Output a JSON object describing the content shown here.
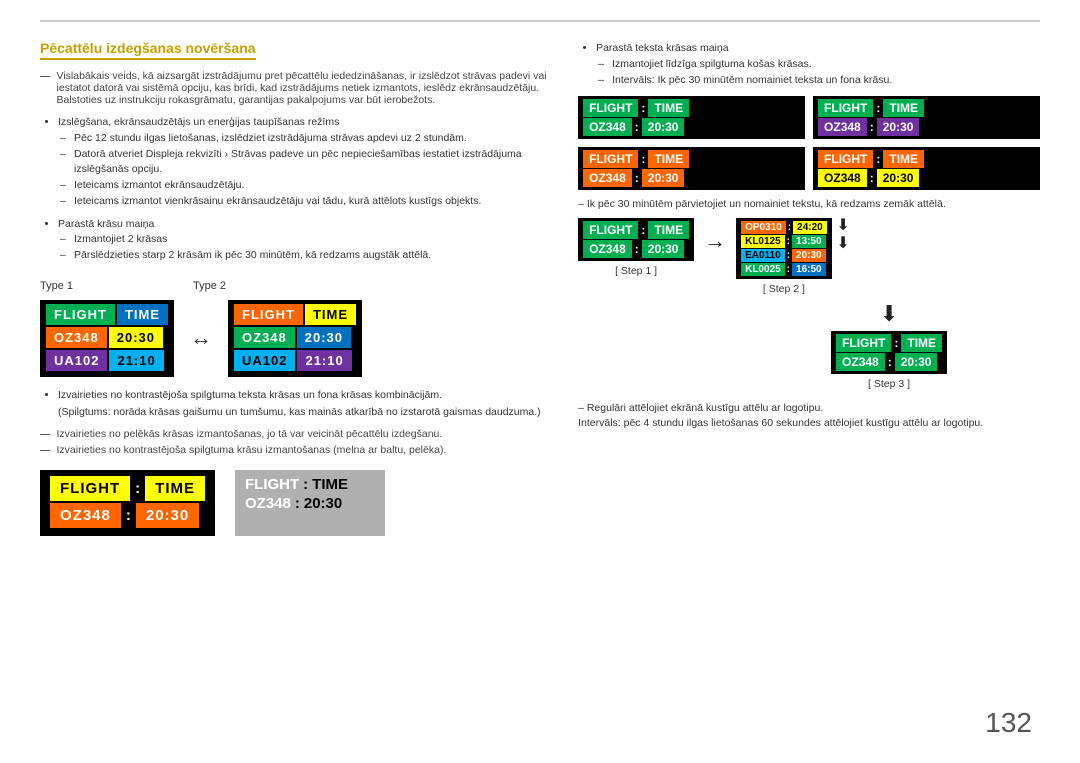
{
  "page": {
    "number": "132",
    "top_rule": true
  },
  "section": {
    "title": "Pēcattēlu izdegšanas novēršana"
  },
  "left": {
    "note1": "Vislabākais veids, kā aizsargāt izstrādājumu pret pēcattēlu iededzināšanas, ir izslēdzot strāvas padevi vai iestatot datorā vai sistēmā opciju, kas brīdi, kad izstrādājums netiek izmantots, ieslēdz ekrānsaudzētāju. Balstoties uz instrukciju rokasgrāmatu, garantijas pakalpojums var būt ierobežots.",
    "bullet1": "Izslēgšana, ekrānsaudzētājs un enerģijas taupīšanas režīms",
    "dash1": "Pēc 12 stundu ilgas lietošanas, izslēdziet izstrādājuma strāvas apdevi uz 2 stundām.",
    "dash2": "Datorā atveriet Displeja rekvizīti › Strāvas padeve un pēc nepieciešamības iestatiet izstrādājuma izslēgšanās opciju.",
    "dash3": "Ieteicams izmantot ekrānsaudzētāju.",
    "dash4": "Ieteicams izmantot vienkrāsainu ekrānsaudzētāju vai tādu, kurā attēlots kustīgs objekts.",
    "bullet2": "Parastā krāsu maiņa",
    "dash5": "Izmantojiet 2 krāsas",
    "dash6": "Pārslēdzieties starp 2 krāsām ik pēc 30 minūtēm, kā redzams augstāk attēlā.",
    "type1_label": "Type 1",
    "type2_label": "Type 2",
    "type1": {
      "row1": [
        "FLIGHT",
        "TIME"
      ],
      "row2": [
        "OZ348",
        "20:30"
      ],
      "row3": [
        "UA102",
        "21:10"
      ]
    },
    "type2": {
      "row1": [
        "FLIGHT",
        "TIME"
      ],
      "row2": [
        "OZ348",
        "20:30"
      ],
      "row3": [
        "UA102",
        "21:10"
      ]
    },
    "note2": "Izvairieties no kontrastējoša spilgtuma teksta krāsas un fona krāsas kombinācijām.",
    "note2b": "(Spilgtums: norāda krāsas gaišumu un tumšumu, kas mainās atkarībā no izstarotā gaismas daudzuma.)",
    "note3": "Izvairieties no pelēkās krāsas izmantošanas, jo tā var veicināt pēcattēlu izdegšanu.",
    "note4": "Izvairieties no kontrastējoša spilgtuma krāsu izmantošanas (melna ar baltu, pelēka).",
    "bottom_board1": {
      "header": [
        "FLIGHT",
        ":",
        "TIME"
      ],
      "data": [
        "OZ348",
        ":",
        "20:30"
      ]
    },
    "bottom_board2": {
      "header": [
        "FLIGHT",
        ":",
        "TIME"
      ],
      "data": [
        "OZ348",
        ":",
        "20:30"
      ]
    }
  },
  "right": {
    "bullet1": "Parastā teksta krāsas maiņa",
    "dash1": "Izmantojiet līdzīga spilgtuma košas krāsas.",
    "dash2": "Intervāls: Ik pēc 30 minūtēm nomainiet teksta un fona krāsu.",
    "boards": [
      {
        "id": "gg",
        "header_bg": "#00b050",
        "header_color": "#fff",
        "data_bg": "#00b050",
        "data_color": "#fff",
        "header": [
          "FLIGHT",
          ":",
          "TIME"
        ],
        "data": [
          "OZ348",
          ":",
          "20:30"
        ]
      },
      {
        "id": "gp",
        "header_bg": "#00b050",
        "header_color": "#fff",
        "data_bg": "#7030a0",
        "data_color": "#fff",
        "header": [
          "FLIGHT",
          ":",
          "TIME"
        ],
        "data": [
          "OZ348",
          ":",
          "20:30"
        ]
      },
      {
        "id": "oo",
        "header_bg": "#ff6600",
        "header_color": "#fff",
        "data_bg": "#ff6600",
        "data_color": "#fff",
        "header": [
          "FLIGHT",
          ":",
          "TIME"
        ],
        "data": [
          "OZ348",
          ":",
          "20:30"
        ]
      },
      {
        "id": "oy",
        "header_bg": "#ff6600",
        "header_color": "#fff",
        "data_bg": "#ffff00",
        "data_color": "#000",
        "header": [
          "FLIGHT",
          ":",
          "TIME"
        ],
        "data": [
          "OZ348",
          ":",
          "20:30"
        ]
      }
    ],
    "step_note": "– Ik pēc 30 minūtēm pārvietojiet un nomainiet tekstu, kā redzams zemāk attēlā.",
    "step1_label": "[ Step 1 ]",
    "step2_label": "[ Step 2 ]",
    "step3_label": "[ Step 3 ]",
    "step1_board": {
      "header": [
        "FLIGHT",
        ":",
        "TIME"
      ],
      "data": [
        "OZ348",
        ":",
        "20:30"
      ]
    },
    "step2_board": {
      "rows": [
        {
          "label": "OP0310",
          "colon": ":",
          "value": "24:20",
          "bg1": "#ff6600",
          "c1": "#fff",
          "bg2": "#ffff00",
          "c2": "#000"
        },
        {
          "label": "KL0125",
          "colon": ":",
          "value": "13:50",
          "bg1": "#ffff00",
          "c1": "#000",
          "bg2": "#00b050",
          "c2": "#fff"
        },
        {
          "label": "EA0110",
          "colon": ":",
          "value": "20:30",
          "bg1": "#00b0f0",
          "c1": "#000",
          "bg2": "#ff6600",
          "c2": "#fff"
        },
        {
          "label": "KL0025",
          "colon": ":",
          "value": "16:50",
          "bg1": "#00b050",
          "c1": "#fff",
          "bg2": "#0070c0",
          "c2": "#fff"
        }
      ]
    },
    "step3_board": {
      "header": [
        "FLIGHT",
        ":",
        "TIME"
      ],
      "data": [
        "OZ348",
        ":",
        "20:30"
      ]
    },
    "note_final1": "– Regulāri attēlojiet ekrānā kustīgu attēlu ar logotipu.",
    "note_final2": "Intervāls: pēc 4 stundu ilgas lietošanas 60 sekundes attēlojiet kustīgu attēlu ar logotipu."
  }
}
